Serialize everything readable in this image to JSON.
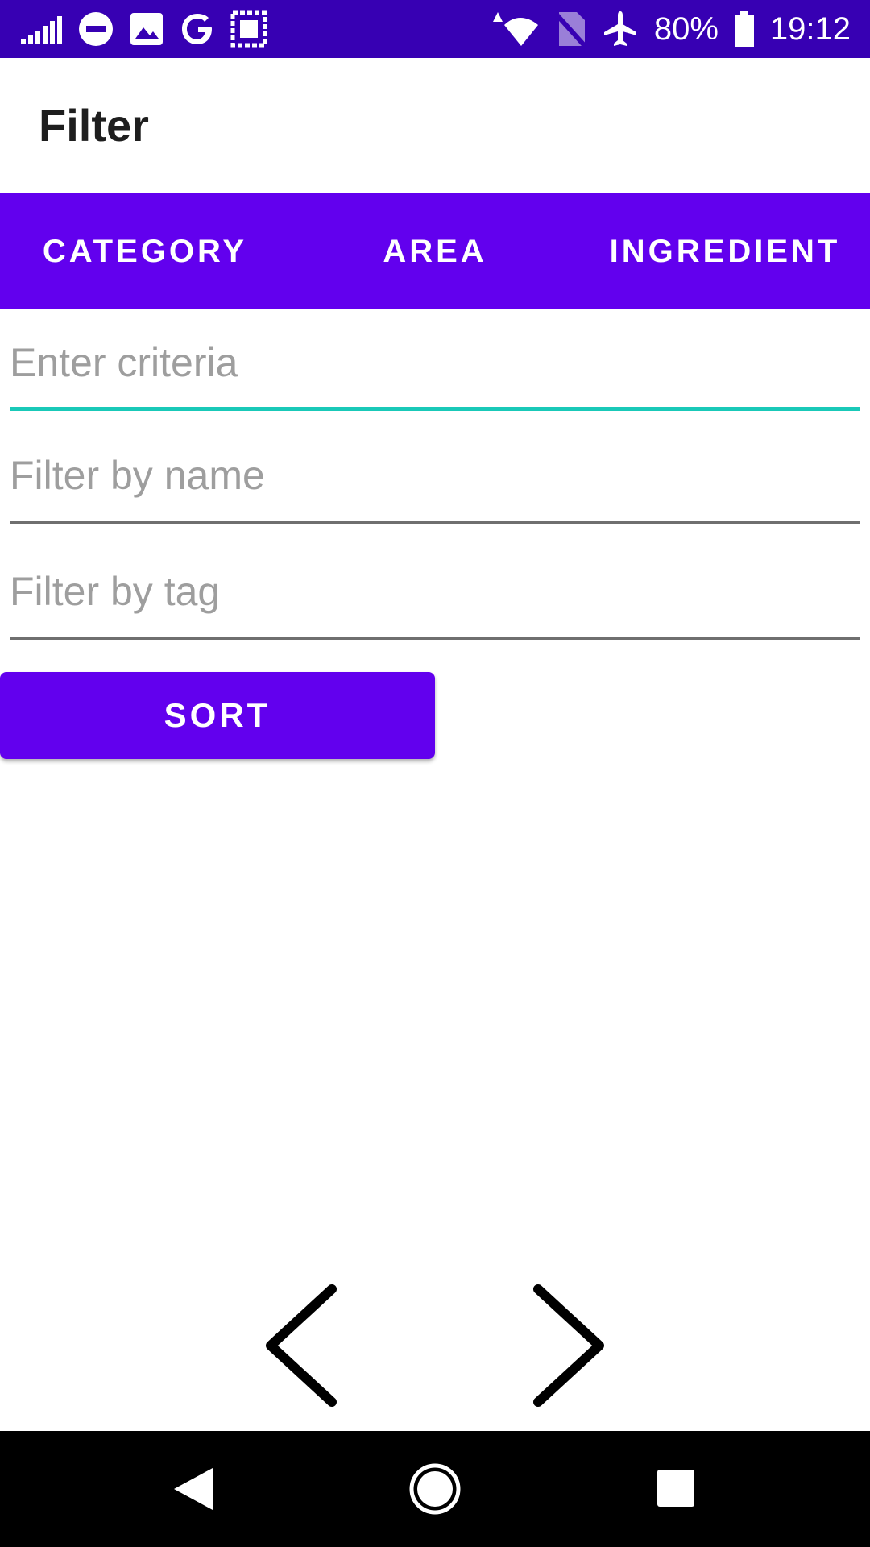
{
  "status_bar": {
    "battery_percent": "80%",
    "time": "19:12",
    "background_color": "#3700b3",
    "left_icons": [
      "signal-bars-icon",
      "do-not-disturb-icon",
      "image-icon",
      "google-icon",
      "screenshot-icon"
    ],
    "right_icons": [
      "wifi-icon",
      "no-sim-icon",
      "airplane-icon",
      "battery-icon"
    ]
  },
  "app_bar": {
    "title": "Filter"
  },
  "tabs": [
    {
      "label": "CATEGORY"
    },
    {
      "label": "AREA"
    },
    {
      "label": "INGREDIENT"
    }
  ],
  "tabs_color": "#6200ee",
  "fields": {
    "criteria": {
      "placeholder": "Enter criteria",
      "value": "",
      "focused": true,
      "accent": "#19c9b8"
    },
    "name": {
      "placeholder": "Filter by name",
      "value": ""
    },
    "tag": {
      "placeholder": "Filter by tag",
      "value": ""
    }
  },
  "sort_button": {
    "label": "SORT",
    "color": "#6200ee"
  },
  "pager": {
    "prev_icon": "chevron-left-icon",
    "next_icon": "chevron-right-icon"
  },
  "nav_bar": {
    "back_icon": "back-triangle-icon",
    "home_icon": "home-circle-icon",
    "recents_icon": "recents-square-icon"
  }
}
